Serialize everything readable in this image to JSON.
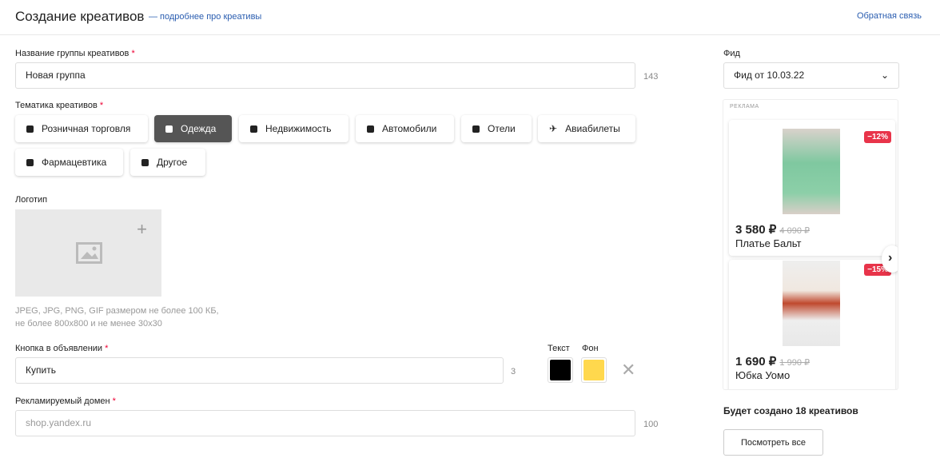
{
  "header": {
    "title": "Создание креативов",
    "more_link": "— подробнее про креативы",
    "feedback": "Обратная связь"
  },
  "group_name": {
    "label": "Название группы креативов",
    "value": "Новая группа",
    "count": "143"
  },
  "theme": {
    "label": "Тематика креативов",
    "items": [
      {
        "label": "Розничная торговля",
        "icon": "shopping-bag-icon"
      },
      {
        "label": "Одежда",
        "icon": "tshirt-icon",
        "active": true
      },
      {
        "label": "Недвижимость",
        "icon": "building-icon"
      },
      {
        "label": "Автомобили",
        "icon": "car-icon"
      },
      {
        "label": "Отели",
        "icon": "bed-icon"
      },
      {
        "label": "Авиабилеты",
        "icon": "plane-icon"
      },
      {
        "label": "Фармацевтика",
        "icon": "medkit-icon"
      },
      {
        "label": "Другое",
        "icon": "briefcase-icon"
      }
    ]
  },
  "logo": {
    "label": "Логотип",
    "hint1": "JPEG, JPG, PNG, GIF размером не более 100 КБ,",
    "hint2": "не более 800x800 и не менее 30x30"
  },
  "button": {
    "label": "Кнопка в объявлении",
    "value": "Купить",
    "count": "3",
    "text_label": "Текст",
    "bg_label": "Фон",
    "text_color": "#000000",
    "bg_color": "#ffd84d"
  },
  "domain": {
    "label": "Рекламируемый домен",
    "placeholder": "shop.yandex.ru",
    "count": "100"
  },
  "feed": {
    "label": "Фид",
    "value": "Фид от 10.03.22"
  },
  "preview": {
    "ad_label": "РЕКЛАМА",
    "products": [
      {
        "price": "3 580 ₽",
        "old_price": "4 090 ₽",
        "name": "Платье Бальт",
        "discount": "−12%"
      },
      {
        "price": "1 690 ₽",
        "old_price": "1 990 ₽",
        "name": "Юбка Уомо",
        "discount": "−15%"
      }
    ]
  },
  "summary": "Будет создано 18 креативов",
  "view_all": "Посмотреть все"
}
